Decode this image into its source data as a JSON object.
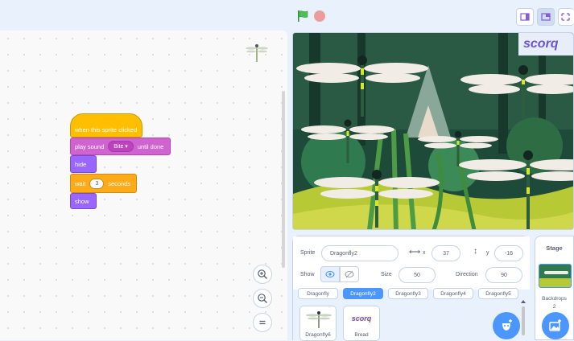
{
  "header": {
    "green_flag_icon": "green-flag-icon",
    "stop_icon": "stop-icon",
    "layout_buttons": [
      "small-stage-icon",
      "normal-stage-icon",
      "fullscreen-icon"
    ]
  },
  "script": {
    "hat_label": "when this sprite clicked",
    "play_sound_prefix": "play sound",
    "play_sound_value": "Bite",
    "play_sound_suffix": "until done",
    "hide_label": "hide",
    "wait_prefix": "wait",
    "wait_value": "3",
    "wait_suffix": "seconds",
    "show_label": "show",
    "zoom_in_icon": "zoom-in-icon",
    "zoom_out_icon": "zoom-out-icon",
    "reset_zoom_icon": "reset-zoom-icon"
  },
  "stage": {
    "sign_text": "scorq"
  },
  "sprite_info": {
    "sprite_label": "Sprite",
    "sprite_name": "Dragonfly2",
    "x_label": "x",
    "x_value": "37",
    "y_label": "y",
    "y_value": "-16",
    "show_label": "Show",
    "size_label": "Size",
    "size_value": "50",
    "direction_label": "Direction",
    "direction_value": "90"
  },
  "sprite_list": {
    "tabs": [
      "Dragonfly",
      "Dragonfly2",
      "Dragonfly3",
      "Dragonfly4",
      "Dragonfly5"
    ],
    "selected": "Dragonfly2",
    "tiles": [
      {
        "name": "Dragonfly6",
        "icon": "dragonfly-icon"
      },
      {
        "name": "Bread",
        "icon": "scorq-text-icon",
        "text": "scorq"
      }
    ]
  },
  "stage_panel": {
    "title": "Stage",
    "backdrops_label": "Backdrops",
    "backdrops_count": "2"
  },
  "colors": {
    "accent": "#4c97ff",
    "events": "#ffbf00",
    "sound": "#cf63cf",
    "looks": "#9966ff",
    "control": "#ffab19"
  }
}
